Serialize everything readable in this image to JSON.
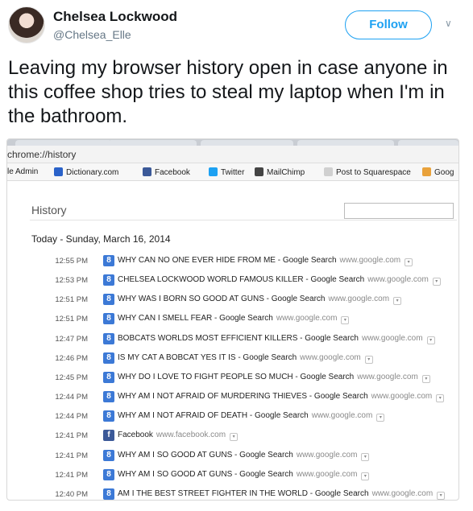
{
  "tweet": {
    "name": "Chelsea Lockwood",
    "handle": "@Chelsea_Elle",
    "follow_label": "Follow",
    "text": "Leaving my browser history open in case anyone in this coffee shop tries to steal my laptop when I'm in the bathroom."
  },
  "browser": {
    "url": "chrome://history",
    "bookmarks": [
      {
        "label": "le Admin",
        "icon": "page-icon",
        "color": "#9aa4b1"
      },
      {
        "label": "Dictionary.com",
        "icon": "dictionary-icon",
        "color": "#2a62c9"
      },
      {
        "label": "Facebook",
        "icon": "facebook-icon",
        "color": "#3b5998"
      },
      {
        "label": "Twitter",
        "icon": "twitter-bird-icon",
        "color": "#1da1f2"
      },
      {
        "label": "MailChimp",
        "icon": "mailchimp-icon",
        "color": "#444444"
      },
      {
        "label": "Post to Squarespace",
        "icon": "page-icon",
        "color": "#d0d0d0"
      },
      {
        "label": "Goog",
        "icon": "google-icon",
        "color": "#e9a23b"
      }
    ],
    "history_title": "History",
    "date_heading": "Today - Sunday, March 16, 2014",
    "entries": [
      {
        "time": "12:55 PM",
        "favicon": "google",
        "title": "WHY CAN NO ONE EVER HIDE FROM ME - Google Search",
        "domain": "www.google.com"
      },
      {
        "time": "12:53 PM",
        "favicon": "google",
        "title": "CHELSEA LOCKWOOD WORLD FAMOUS KILLER - Google Search",
        "domain": "www.google.com"
      },
      {
        "time": "12:51 PM",
        "favicon": "google",
        "title": "WHY WAS I BORN SO GOOD AT GUNS - Google Search",
        "domain": "www.google.com"
      },
      {
        "time": "12:51 PM",
        "favicon": "google",
        "title": "WHY CAN I SMELL FEAR - Google Search",
        "domain": "www.google.com"
      },
      {
        "time": "12:47 PM",
        "favicon": "google",
        "title": "BOBCATS WORLDS MOST EFFICIENT KILLERS - Google Search",
        "domain": "www.google.com"
      },
      {
        "time": "12:46 PM",
        "favicon": "google",
        "title": "IS MY CAT A BOBCAT YES IT IS - Google Search",
        "domain": "www.google.com"
      },
      {
        "time": "12:45 PM",
        "favicon": "google",
        "title": "WHY DO I LOVE TO FIGHT PEOPLE SO MUCH - Google Search",
        "domain": "www.google.com"
      },
      {
        "time": "12:44 PM",
        "favicon": "google",
        "title": "WHY AM I NOT AFRAID OF MURDERING THIEVES - Google Search",
        "domain": "www.google.com"
      },
      {
        "time": "12:44 PM",
        "favicon": "google",
        "title": "WHY AM I NOT AFRAID OF DEATH - Google Search",
        "domain": "www.google.com"
      },
      {
        "time": "12:41 PM",
        "favicon": "facebook",
        "title": "Facebook",
        "domain": "www.facebook.com"
      },
      {
        "time": "12:41 PM",
        "favicon": "google",
        "title": "WHY AM I SO GOOD AT GUNS - Google Search",
        "domain": "www.google.com"
      },
      {
        "time": "12:41 PM",
        "favicon": "google",
        "title": "WHY AM I SO GOOD AT GUNS - Google Search",
        "domain": "www.google.com"
      },
      {
        "time": "12:40 PM",
        "favicon": "google",
        "title": "AM I THE BEST STREET FIGHTER IN THE WORLD - Google Search",
        "domain": "www.google.com"
      }
    ]
  },
  "colors": {
    "accent": "#1da1f2",
    "google_favicon": "#3c79d6",
    "facebook_favicon": "#3b5998"
  }
}
